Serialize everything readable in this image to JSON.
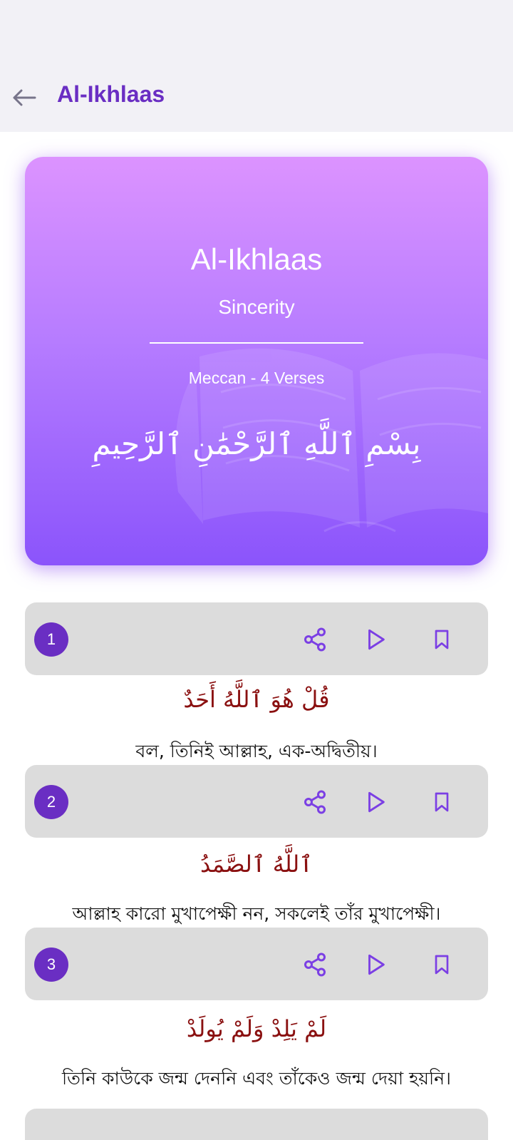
{
  "appbar": {
    "title": "Al-Ikhlaas",
    "back_icon": "arrow-left-icon"
  },
  "hero": {
    "title": "Al-Ikhlaas",
    "subtitle": "Sincerity",
    "meta": "Meccan - 4 Verses",
    "bismillah": "بِسْمِ ٱللَّهِ ٱلرَّحْمَٰنِ ٱلرَّحِيمِ"
  },
  "verses": [
    {
      "number": "1",
      "arabic": "قُلْ هُوَ ٱللَّهُ أَحَدٌ",
      "translation": "বল, তিনিই আল্লাহ, এক-অদ্বিতীয়।"
    },
    {
      "number": "2",
      "arabic": "ٱللَّهُ ٱلصَّمَدُ",
      "translation": "আল্লাহ কারো মুখাপেক্ষী নন, সকলেই তাঁর মুখাপেক্ষী।"
    },
    {
      "number": "3",
      "arabic": "لَمْ يَلِدْ وَلَمْ يُولَدْ",
      "translation": "তিনি কাউকে জন্ম দেননি এবং তাঁকেও জন্ম দেয়া হয়নি।"
    }
  ],
  "icons": {
    "share": "share-icon",
    "play": "play-icon",
    "bookmark": "bookmark-icon"
  },
  "colors": {
    "accent": "#6a2ec3",
    "icon": "#7b3fe4",
    "arabic_text": "#8a1010",
    "verse_bar": "#dcdcdc",
    "hero_gradient_top": "#dc93ff",
    "hero_gradient_bottom": "#8b54fb"
  }
}
